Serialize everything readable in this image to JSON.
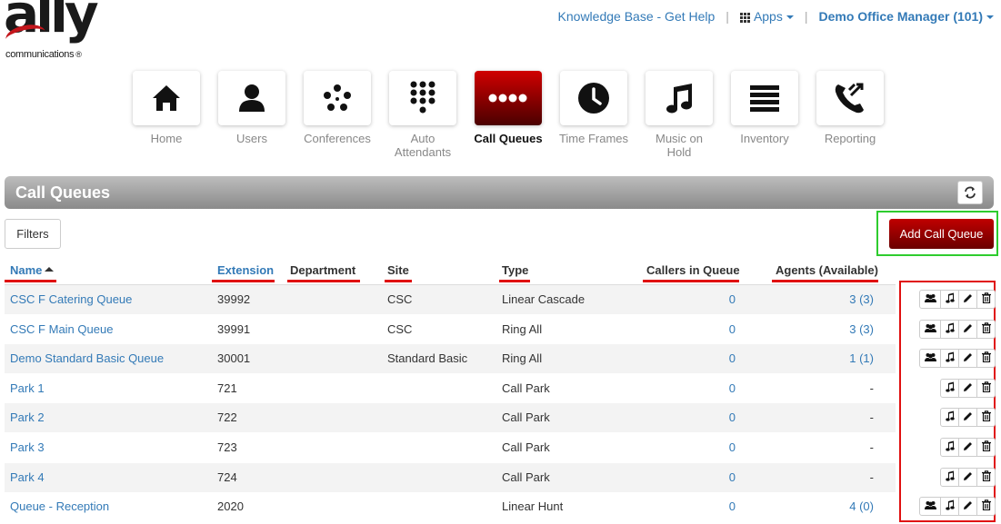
{
  "logo": {
    "word": "ally",
    "sub": "communications",
    "reg": "®"
  },
  "topnav": {
    "kb": "Knowledge Base - Get Help",
    "apps": "Apps",
    "user": "Demo Office Manager (101)"
  },
  "tiles": [
    {
      "label": "Home",
      "icon": "home-icon"
    },
    {
      "label": "Users",
      "icon": "user-icon"
    },
    {
      "label": "Conferences",
      "icon": "conference-icon"
    },
    {
      "label": "Auto Attendants",
      "icon": "keypad-icon"
    },
    {
      "label": "Call Queues",
      "icon": "queue-icon",
      "active": true
    },
    {
      "label": "Time Frames",
      "icon": "clock-icon"
    },
    {
      "label": "Music on Hold",
      "icon": "music-icon"
    },
    {
      "label": "Inventory",
      "icon": "list-icon"
    },
    {
      "label": "Reporting",
      "icon": "phone-report-icon"
    }
  ],
  "section": {
    "title": "Call Queues"
  },
  "toolbar": {
    "filters": "Filters",
    "add": "Add Call Queue"
  },
  "table": {
    "headers": {
      "name": "Name",
      "extension": "Extension",
      "department": "Department",
      "site": "Site",
      "type": "Type",
      "callers": "Callers in Queue",
      "agents": "Agents (Available)"
    },
    "rows": [
      {
        "name": "CSC F Catering Queue",
        "ext": "39992",
        "dept": "",
        "site": "CSC",
        "type": "Linear Cascade",
        "callers": "0",
        "agents": "3 (3)",
        "agents_btn": true
      },
      {
        "name": "CSC F Main Queue",
        "ext": "39991",
        "dept": "",
        "site": "CSC",
        "type": "Ring All",
        "callers": "0",
        "agents": "3 (3)",
        "agents_btn": true
      },
      {
        "name": "Demo Standard Basic Queue",
        "ext": "30001",
        "dept": "",
        "site": "Standard Basic",
        "type": "Ring All",
        "callers": "0",
        "agents": "1 (1)",
        "agents_btn": true
      },
      {
        "name": "Park 1",
        "ext": "721",
        "dept": "",
        "site": "",
        "type": "Call Park",
        "callers": "0",
        "agents": "-",
        "agents_btn": false
      },
      {
        "name": "Park 2",
        "ext": "722",
        "dept": "",
        "site": "",
        "type": "Call Park",
        "callers": "0",
        "agents": "-",
        "agents_btn": false
      },
      {
        "name": "Park 3",
        "ext": "723",
        "dept": "",
        "site": "",
        "type": "Call Park",
        "callers": "0",
        "agents": "-",
        "agents_btn": false
      },
      {
        "name": "Park 4",
        "ext": "724",
        "dept": "",
        "site": "",
        "type": "Call Park",
        "callers": "0",
        "agents": "-",
        "agents_btn": false
      },
      {
        "name": "Queue - Reception",
        "ext": "2020",
        "dept": "",
        "site": "",
        "type": "Linear Hunt",
        "callers": "0",
        "agents": "4 (0)",
        "agents_btn": true
      }
    ]
  },
  "colors": {
    "link": "#337ab7",
    "accent_red": "#c00000",
    "highlight_green": "#2ecc2e",
    "underline_red": "#e01010"
  }
}
